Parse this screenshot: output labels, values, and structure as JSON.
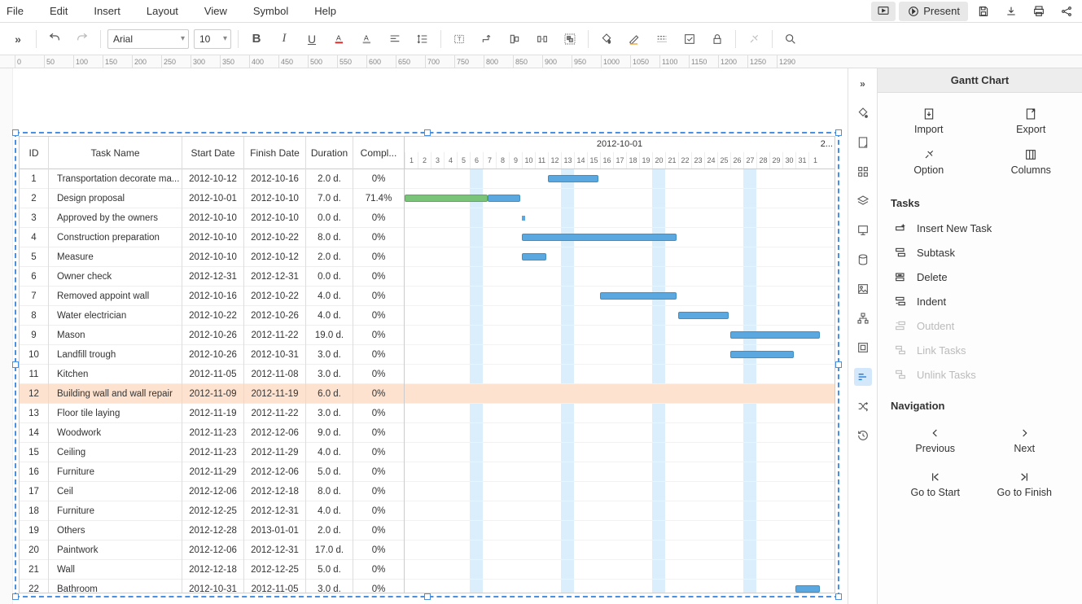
{
  "menu": [
    "File",
    "Edit",
    "Insert",
    "Layout",
    "View",
    "Symbol",
    "Help"
  ],
  "present_label": "Present",
  "font": "Arial",
  "fontsize": "10",
  "ruler_ticks": [
    0,
    50,
    100,
    150,
    200,
    250,
    300,
    350,
    400,
    450,
    500,
    550,
    600,
    650,
    700,
    750,
    800,
    850,
    900,
    950,
    1000,
    1050,
    1100,
    1150,
    1200,
    1250,
    1290
  ],
  "columns": [
    "ID",
    "Task Name",
    "Start Date",
    "Finish Date",
    "Duration",
    "Compl..."
  ],
  "timeline_month": "2012-10-01",
  "timeline_days_end": "2...",
  "days": [
    1,
    2,
    3,
    4,
    5,
    6,
    7,
    8,
    9,
    10,
    11,
    12,
    13,
    14,
    15,
    16,
    17,
    18,
    19,
    20,
    21,
    22,
    23,
    24,
    25,
    26,
    27,
    28,
    29,
    30,
    31,
    1
  ],
  "weekend_cols": [
    5,
    12,
    19,
    26
  ],
  "selected_row": 12,
  "tasks": [
    {
      "id": 1,
      "name": "Transportation decorate ma...",
      "start": "2012-10-12",
      "finish": "2012-10-16",
      "dur": "2.0 d.",
      "comp": "0%",
      "bar_start": 11,
      "bar_len": 4,
      "color": "blue"
    },
    {
      "id": 2,
      "name": "Design proposal",
      "start": "2012-10-01",
      "finish": "2012-10-10",
      "dur": "7.0 d.",
      "comp": "71.4%",
      "bar_start": 0,
      "bar_len": 9,
      "color": "green",
      "done_len": 6.4
    },
    {
      "id": 3,
      "name": "Approved by the owners",
      "start": "2012-10-10",
      "finish": "2012-10-10",
      "dur": "0.0 d.",
      "comp": "0%",
      "ms_at": 9
    },
    {
      "id": 4,
      "name": "Construction preparation",
      "start": "2012-10-10",
      "finish": "2012-10-22",
      "dur": "8.0 d.",
      "comp": "0%",
      "bar_start": 9,
      "bar_len": 12,
      "color": "blue"
    },
    {
      "id": 5,
      "name": "Measure",
      "start": "2012-10-10",
      "finish": "2012-10-12",
      "dur": "2.0 d.",
      "comp": "0%",
      "bar_start": 9,
      "bar_len": 2,
      "color": "blue"
    },
    {
      "id": 6,
      "name": "Owner check",
      "start": "2012-12-31",
      "finish": "2012-12-31",
      "dur": "0.0 d.",
      "comp": "0%"
    },
    {
      "id": 7,
      "name": "Removed appoint wall",
      "start": "2012-10-16",
      "finish": "2012-10-22",
      "dur": "4.0 d.",
      "comp": "0%",
      "bar_start": 15,
      "bar_len": 6,
      "color": "blue"
    },
    {
      "id": 8,
      "name": "Water electrician",
      "start": "2012-10-22",
      "finish": "2012-10-26",
      "dur": "4.0 d.",
      "comp": "0%",
      "bar_start": 21,
      "bar_len": 4,
      "color": "blue"
    },
    {
      "id": 9,
      "name": "Mason",
      "start": "2012-10-26",
      "finish": "2012-11-22",
      "dur": "19.0 d.",
      "comp": "0%",
      "bar_start": 25,
      "bar_len": 7,
      "color": "blue"
    },
    {
      "id": 10,
      "name": "Landfill trough",
      "start": "2012-10-26",
      "finish": "2012-10-31",
      "dur": "3.0 d.",
      "comp": "0%",
      "bar_start": 25,
      "bar_len": 5,
      "color": "blue"
    },
    {
      "id": 11,
      "name": "Kitchen",
      "start": "2012-11-05",
      "finish": "2012-11-08",
      "dur": "3.0 d.",
      "comp": "0%"
    },
    {
      "id": 12,
      "name": "Building wall and wall repair",
      "start": "2012-11-09",
      "finish": "2012-11-19",
      "dur": "6.0 d.",
      "comp": "0%"
    },
    {
      "id": 13,
      "name": "Floor tile laying",
      "start": "2012-11-19",
      "finish": "2012-11-22",
      "dur": "3.0 d.",
      "comp": "0%"
    },
    {
      "id": 14,
      "name": "Woodwork",
      "start": "2012-11-23",
      "finish": "2012-12-06",
      "dur": "9.0 d.",
      "comp": "0%"
    },
    {
      "id": 15,
      "name": "Ceiling",
      "start": "2012-11-23",
      "finish": "2012-11-29",
      "dur": "4.0 d.",
      "comp": "0%"
    },
    {
      "id": 16,
      "name": "Furniture",
      "start": "2012-11-29",
      "finish": "2012-12-06",
      "dur": "5.0 d.",
      "comp": "0%"
    },
    {
      "id": 17,
      "name": "Ceil",
      "start": "2012-12-06",
      "finish": "2012-12-18",
      "dur": "8.0 d.",
      "comp": "0%"
    },
    {
      "id": 18,
      "name": "Furniture",
      "start": "2012-12-25",
      "finish": "2012-12-31",
      "dur": "4.0 d.",
      "comp": "0%"
    },
    {
      "id": 19,
      "name": "Others",
      "start": "2012-12-28",
      "finish": "2013-01-01",
      "dur": "2.0 d.",
      "comp": "0%"
    },
    {
      "id": 20,
      "name": "Paintwork",
      "start": "2012-12-06",
      "finish": "2012-12-31",
      "dur": "17.0 d.",
      "comp": "0%"
    },
    {
      "id": 21,
      "name": "Wall",
      "start": "2012-12-18",
      "finish": "2012-12-25",
      "dur": "5.0 d.",
      "comp": "0%"
    },
    {
      "id": 22,
      "name": "Bathroom",
      "start": "2012-10-31",
      "finish": "2012-11-05",
      "dur": "3.0 d.",
      "comp": "0%",
      "bar_start": 30,
      "bar_len": 2,
      "color": "blue"
    }
  ],
  "panel": {
    "title": "Gantt Chart",
    "import": "Import",
    "export": "Export",
    "option": "Option",
    "columns": "Columns",
    "tasks_title": "Tasks",
    "insert": "Insert New Task",
    "subtask": "Subtask",
    "delete": "Delete",
    "indent": "Indent",
    "outdent": "Outdent",
    "link": "Link Tasks",
    "unlink": "Unlink Tasks",
    "nav_title": "Navigation",
    "prev": "Previous",
    "next": "Next",
    "gostart": "Go to Start",
    "goend": "Go to Finish"
  }
}
